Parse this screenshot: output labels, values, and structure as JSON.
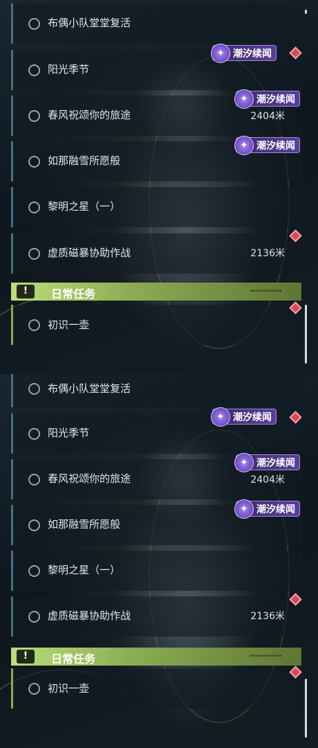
{
  "panels": [
    {
      "tasks": [
        {
          "title": "布偶小队堂堂复活"
        },
        {
          "title": "阳光季节",
          "badge": "潮汐续闻",
          "marker": true
        },
        {
          "title": "春风祝颂你的旅途",
          "badge": "潮汐续闻",
          "distance": "2404米"
        },
        {
          "title": "如那融雪所愿般",
          "badge": "潮汐续闻"
        },
        {
          "title": "黎明之星（一）"
        },
        {
          "title": "虚质磁暴协助作战",
          "distance": "2136米",
          "marker": true
        }
      ],
      "daily": {
        "header": "日常任务",
        "tasks": [
          {
            "title": "初识一壶",
            "marker": true
          }
        ]
      }
    },
    {
      "tasks": [
        {
          "title": "布偶小队堂堂复活"
        },
        {
          "title": "阳光季节",
          "badge": "潮汐续闻",
          "marker": true
        },
        {
          "title": "春风祝颂你的旅途",
          "badge": "潮汐续闻",
          "distance": "2404米"
        },
        {
          "title": "如那融雪所愿般",
          "badge": "潮汐续闻"
        },
        {
          "title": "黎明之星（一）"
        },
        {
          "title": "虚质磁暴协助作战",
          "distance": "2136米",
          "marker": true
        }
      ],
      "daily": {
        "header": "日常任务",
        "tasks": [
          {
            "title": "初识一壶",
            "marker": true
          }
        ]
      }
    }
  ],
  "icons": {
    "badge": "tidal-star-icon",
    "marker": "diamond-marker-icon",
    "header": "exclamation-icon",
    "status": "circle-icon"
  },
  "colors": {
    "badge": "#5a3f9a",
    "marker": "#d8495a",
    "header": "#a8cc69",
    "row_accent": "#4b6e82",
    "daily_accent": "#89ac4d"
  }
}
